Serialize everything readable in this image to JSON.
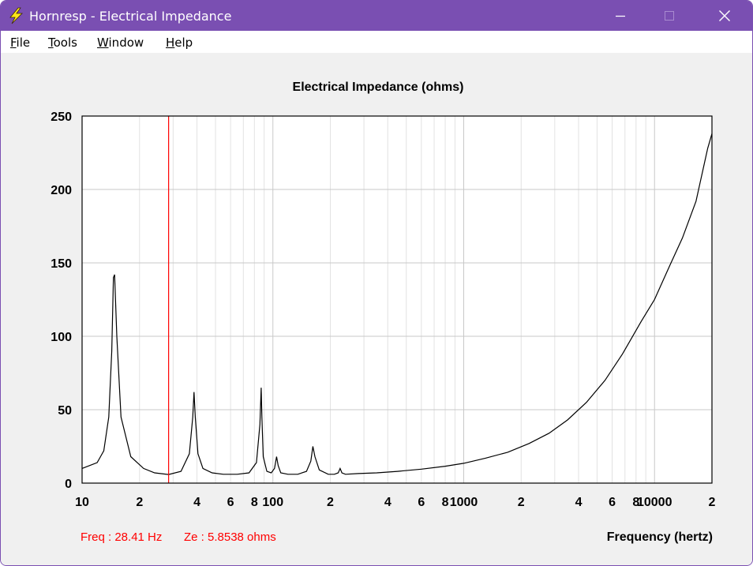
{
  "window": {
    "title": "Hornresp - Electrical Impedance",
    "controls": [
      "minimize",
      "maximize",
      "close"
    ]
  },
  "menu": {
    "items": [
      {
        "key": "F",
        "rest": "ile"
      },
      {
        "key": "T",
        "rest": "ools"
      },
      {
        "key": "W",
        "rest": "indow"
      },
      {
        "key": "H",
        "rest": "elp"
      }
    ]
  },
  "readout": {
    "freq": "Freq : 28.41 Hz",
    "ze": "Ze : 5.8538 ohms",
    "color": "#ff0000"
  },
  "colors": {
    "titlebar": "#7a4fb2",
    "plot_bg": "#ffffff",
    "grid_major": "#c8c8c8",
    "grid_minor": "#e2e2e2",
    "curve": "#000000",
    "cursor": "#ff0000"
  },
  "chart_data": {
    "type": "line",
    "title": "Electrical Impedance (ohms)",
    "xlabel": "Frequency (hertz)",
    "ylabel": "",
    "xscale": "log",
    "xlim": [
      10,
      20000
    ],
    "ylim": [
      0,
      250
    ],
    "yticks": [
      0,
      50,
      100,
      150,
      200,
      250
    ],
    "xtick_labels": [
      {
        "v": 10,
        "t": "10"
      },
      {
        "v": 20,
        "t": "2"
      },
      {
        "v": 40,
        "t": "4"
      },
      {
        "v": 60,
        "t": "6"
      },
      {
        "v": 80,
        "t": "8"
      },
      {
        "v": 100,
        "t": "100"
      },
      {
        "v": 200,
        "t": "2"
      },
      {
        "v": 400,
        "t": "4"
      },
      {
        "v": 600,
        "t": "6"
      },
      {
        "v": 800,
        "t": "8"
      },
      {
        "v": 1000,
        "t": "1000"
      },
      {
        "v": 2000,
        "t": "2"
      },
      {
        "v": 4000,
        "t": "4"
      },
      {
        "v": 6000,
        "t": "6"
      },
      {
        "v": 8000,
        "t": "8"
      },
      {
        "v": 10000,
        "t": "10000"
      },
      {
        "v": 20000,
        "t": "2"
      }
    ],
    "grid": true,
    "cursor_x": 28.41,
    "series": [
      {
        "x": [
          10,
          12,
          13,
          13.8,
          14.3,
          14.6,
          14.8,
          15.2,
          16,
          18,
          21,
          24,
          28.41,
          33,
          36.5,
          38,
          38.6,
          39.2,
          40.5,
          43,
          48,
          55,
          65,
          75,
          82,
          85.5,
          86.8,
          87.6,
          89,
          93,
          98,
          102,
          104.5,
          106.5,
          110,
          120,
          135,
          150,
          158,
          162,
          166,
          175,
          195,
          210,
          220,
          225,
          230,
          240,
          280,
          350,
          450,
          600,
          800,
          1000,
          1300,
          1700,
          2200,
          2800,
          3500,
          4400,
          5500,
          6800,
          8500,
          10000,
          12000,
          14000,
          16500,
          19000,
          20000
        ],
        "y": [
          10,
          14,
          22,
          45,
          90,
          140,
          142,
          100,
          45,
          18,
          10,
          7,
          5.85,
          8,
          20,
          45,
          62,
          45,
          20,
          10,
          7,
          6,
          6,
          7,
          14,
          40,
          65,
          45,
          18,
          8,
          7,
          10,
          18,
          12,
          7,
          6,
          6,
          8,
          15,
          25,
          18,
          9,
          6,
          6,
          7,
          10,
          7,
          6,
          6.5,
          7,
          8,
          9.5,
          11.5,
          13.5,
          17,
          21,
          27,
          34,
          43,
          55,
          70,
          88,
          110,
          125,
          148,
          167,
          192,
          228,
          238
        ]
      }
    ]
  }
}
